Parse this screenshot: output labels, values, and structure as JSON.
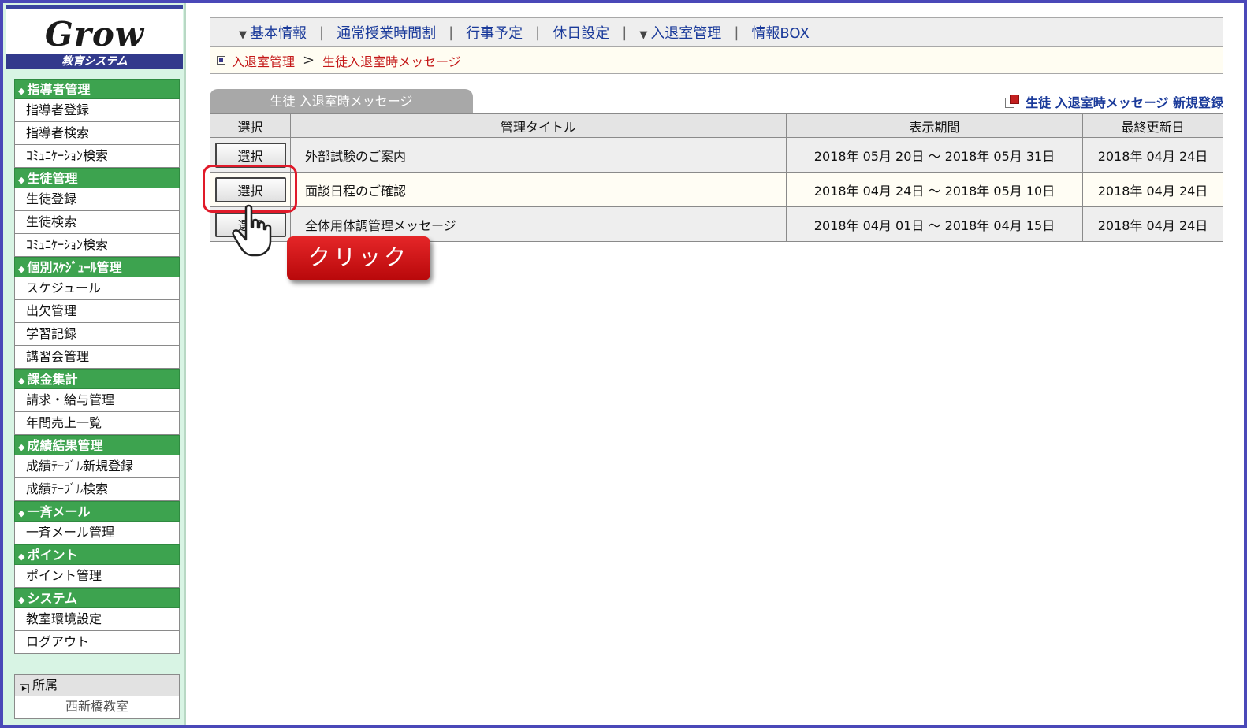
{
  "logo": {
    "text": "Grow",
    "subtitle": "教育システム"
  },
  "sidebar": {
    "sections": [
      {
        "title": "指導者管理",
        "items": [
          "指導者登録",
          "指導者検索",
          "ｺﾐｭﾆｹｰｼｮﾝ検索"
        ]
      },
      {
        "title": "生徒管理",
        "items": [
          "生徒登録",
          "生徒検索",
          "ｺﾐｭﾆｹｰｼｮﾝ検索"
        ]
      },
      {
        "title": "個別ｽｹｼﾞｭｰﾙ管理",
        "items": [
          "スケジュール",
          "出欠管理",
          "学習記録",
          "講習会管理"
        ]
      },
      {
        "title": "課金集計",
        "items": [
          "請求・給与管理",
          "年間売上一覧"
        ]
      },
      {
        "title": "成績結果管理",
        "items": [
          "成績ﾃｰﾌﾞﾙ新規登録",
          "成績ﾃｰﾌﾞﾙ検索"
        ]
      },
      {
        "title": "一斉メール",
        "items": [
          "一斉メール管理"
        ]
      },
      {
        "title": "ポイント",
        "items": [
          "ポイント管理"
        ]
      },
      {
        "title": "システム",
        "items": [
          "教室環境設定",
          "ログアウト"
        ]
      }
    ],
    "affiliation": {
      "label": "所属",
      "value": "西新橋教室"
    }
  },
  "topnav": {
    "items": [
      {
        "label": "基本情報",
        "dropdown": true
      },
      {
        "label": "通常授業時間割",
        "dropdown": false
      },
      {
        "label": "行事予定",
        "dropdown": false
      },
      {
        "label": "休日設定",
        "dropdown": false
      },
      {
        "label": "入退室管理",
        "dropdown": true
      },
      {
        "label": "情報BOX",
        "dropdown": false
      }
    ]
  },
  "breadcrumb": {
    "parent": "入退室管理",
    "separator": ">",
    "current": "生徒入退室時メッセージ"
  },
  "panel": {
    "tab_label": "生徒 入退室時メッセージ",
    "register_link": "生徒 入退室時メッセージ 新規登録"
  },
  "table": {
    "headers": [
      "選択",
      "管理タイトル",
      "表示期間",
      "最終更新日"
    ],
    "button_label": "選択",
    "rows": [
      {
        "title": "外部試験のご案内",
        "period": "2018年 05月 20日 〜 2018年 05月 31日",
        "updated": "2018年 04月 24日"
      },
      {
        "title": "面談日程のご確認",
        "period": "2018年 04月 24日 〜 2018年 05月 10日",
        "updated": "2018年 04月 24日"
      },
      {
        "title": "全体用体調管理メッセージ",
        "period": "2018年 04月 01日 〜 2018年 04月 15日",
        "updated": "2018年 04月 24日"
      }
    ]
  },
  "annotation": {
    "click_label": "クリック",
    "highlight_color": "#e01a2a"
  },
  "colors": {
    "menu_header": "#3da34f",
    "nav_link": "#1a3a9a",
    "breadcrumb": "#c41818",
    "frame": "#4a48b8"
  }
}
